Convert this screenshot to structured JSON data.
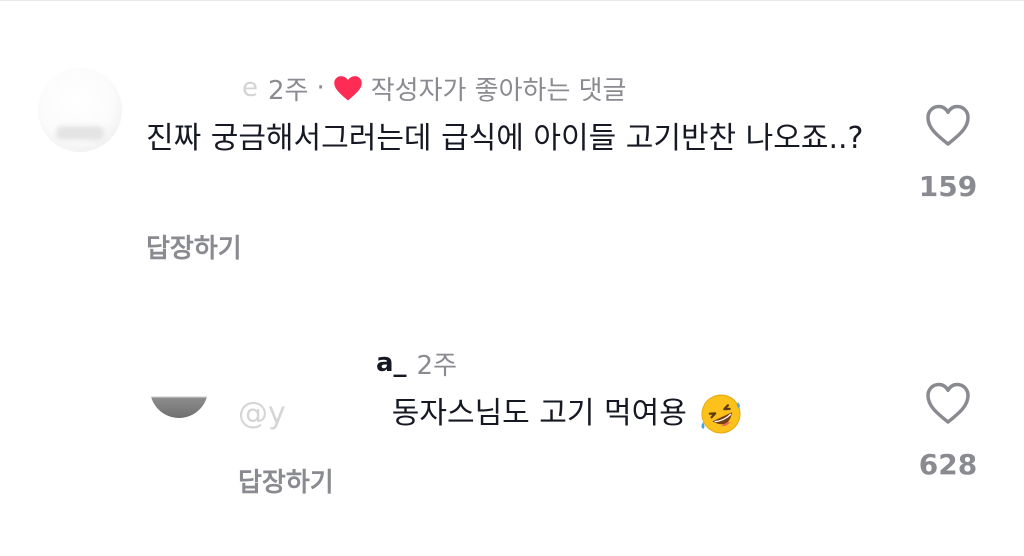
{
  "colors": {
    "text": "#161823",
    "secondary": "#8a8b91",
    "heart": "#fe2c55",
    "faded": "#d4d4d7"
  },
  "comments": [
    {
      "username_visible": "e",
      "time": "2주",
      "separator": "·",
      "creator_liked": "작성자가 좋아하는 댓글",
      "creator_liked_icon": "heart-icon",
      "text": "진짜 궁금해서그러는데 급식에 아이들 고기반찬 나오죠..?",
      "reply_label": "답장하기",
      "like_icon": "heart-outline-icon",
      "like_count": "159"
    },
    {
      "username_visible": "a_",
      "time": "2주",
      "mention_visible": "@y",
      "text": "동자스님도 고기 먹여용",
      "emoji": "rolling-on-floor-laughing",
      "reply_label": "답장하기",
      "like_icon": "heart-outline-icon",
      "like_count": "628"
    }
  ]
}
